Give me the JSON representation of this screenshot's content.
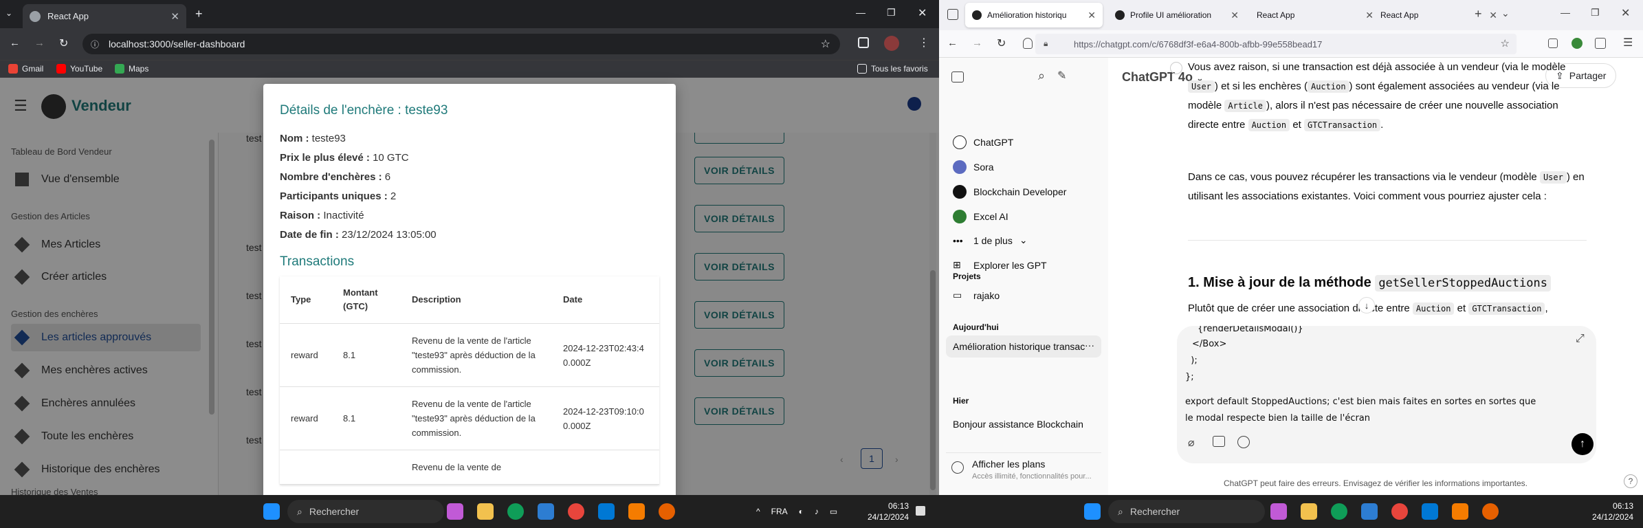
{
  "left_browser": {
    "tab_title": "React App",
    "url": "localhost:3000/seller-dashboard",
    "bookmarks": [
      "Gmail",
      "YouTube",
      "Maps"
    ],
    "all_bookmarks": "Tous les favoris"
  },
  "app": {
    "brand": "Vendeur",
    "sidebar": {
      "section1": "Tableau de Bord Vendeur",
      "overview": "Vue d'ensemble",
      "section2": "Gestion des Articles",
      "my_articles": "Mes Articles",
      "create_articles": "Créer articles",
      "section3": "Gestion des enchères",
      "approved": "Les articles approuvés",
      "active": "Mes enchères actives",
      "cancelled": "Enchères annulées",
      "all": "Toute les enchères",
      "history": "Historique des enchères",
      "section4": "Historique des Ventes"
    },
    "row_prefix": "test",
    "view_details": "VOIR DÉTAILS",
    "page_number": "1"
  },
  "modal": {
    "title": "Détails de l'enchère : teste93",
    "fields": [
      {
        "label": "Nom :",
        "value": "teste93"
      },
      {
        "label": "Prix le plus élevé :",
        "value": "10 GTC"
      },
      {
        "label": "Nombre d'enchères :",
        "value": "6"
      },
      {
        "label": "Participants uniques :",
        "value": "2"
      },
      {
        "label": "Raison :",
        "value": "Inactivité"
      },
      {
        "label": "Date de fin :",
        "value": "23/12/2024 13:05:00"
      }
    ],
    "transactions_title": "Transactions",
    "columns": [
      "Type",
      "Montant (GTC)",
      "Description",
      "Date"
    ],
    "rows": [
      {
        "type": "reward",
        "amount": "8.1",
        "description": "Revenu de la vente de l'article \"teste93\" après déduction de la commission.",
        "date": "2024-12-23T02:43:40.000Z"
      },
      {
        "type": "reward",
        "amount": "8.1",
        "description": "Revenu de la vente de l'article \"teste93\" après déduction de la commission.",
        "date": "2024-12-23T09:10:00.000Z"
      },
      {
        "type": "",
        "amount": "",
        "description": "Revenu de la vente de",
        "date": ""
      }
    ]
  },
  "left_taskbar": {
    "search": "Rechercher",
    "lang": "FRA",
    "time": "06:13",
    "date": "24/12/2024"
  },
  "right_browser": {
    "tabs": [
      "Amélioration historiqu",
      "Profile UI amélioration",
      "React App",
      "React App"
    ],
    "url": "https://chatgpt.com/c/6768df3f-e6a4-800b-afbb-99e558bead17"
  },
  "chatgpt": {
    "sidebar": {
      "items": [
        "ChatGPT",
        "Sora",
        "Blockchain Developer",
        "Excel AI"
      ],
      "more": "1 de plus",
      "explore": "Explorer les GPT",
      "projects": "Projets",
      "project1": "rajako",
      "today": "Aujourd'hui",
      "chat_active": "Amélioration historique transac",
      "yesterday": "Hier",
      "chat_prev": "Bonjour assistance Blockchain",
      "plans": "Afficher les plans",
      "plans_sub": "Accès illimité, fonctionnalités pour..."
    },
    "model": "ChatGPT 4o",
    "share": "Partager",
    "para1_a": "Vous avez raison, si une transaction est déjà associée à un vendeur (via le modèle",
    "para1_b": ") et si les enchères (",
    "para1_c": ") sont également associées au vendeur (via le modèle",
    "para1_d": "), alors il n'est pas nécessaire de créer une nouvelle association directe entre",
    "para1_e": "et",
    "code_user": "User",
    "code_auction": "Auction",
    "code_article": "Article",
    "code_gtc": "GTCTransaction",
    "para2_a": "Dans ce cas, vous pouvez récupérer les transactions via le vendeur (modèle",
    "para2_b": ") en utilisant les associations existantes. Voici comment vous pourriez ajuster cela :",
    "heading": "1. Mise à jour de la méthode",
    "heading_code": "getSellerStoppedAuctions",
    "para3_a": "Plutôt que de créer une association directe entre",
    "para3_b": "et",
    "composer": [
      "{renderDetailsModal()}",
      "</Box>",
      "  );",
      "};",
      "",
      "export default StoppedAuctions; c'est bien mais faites en sortes en sortes que",
      "le modal respecte bien la taille de l'écran"
    ],
    "disclaimer": "ChatGPT peut faire des erreurs. Envisagez de vérifier les informations importantes."
  },
  "right_taskbar": {
    "search": "Rechercher",
    "time": "06:13",
    "date": "24/12/2024"
  }
}
